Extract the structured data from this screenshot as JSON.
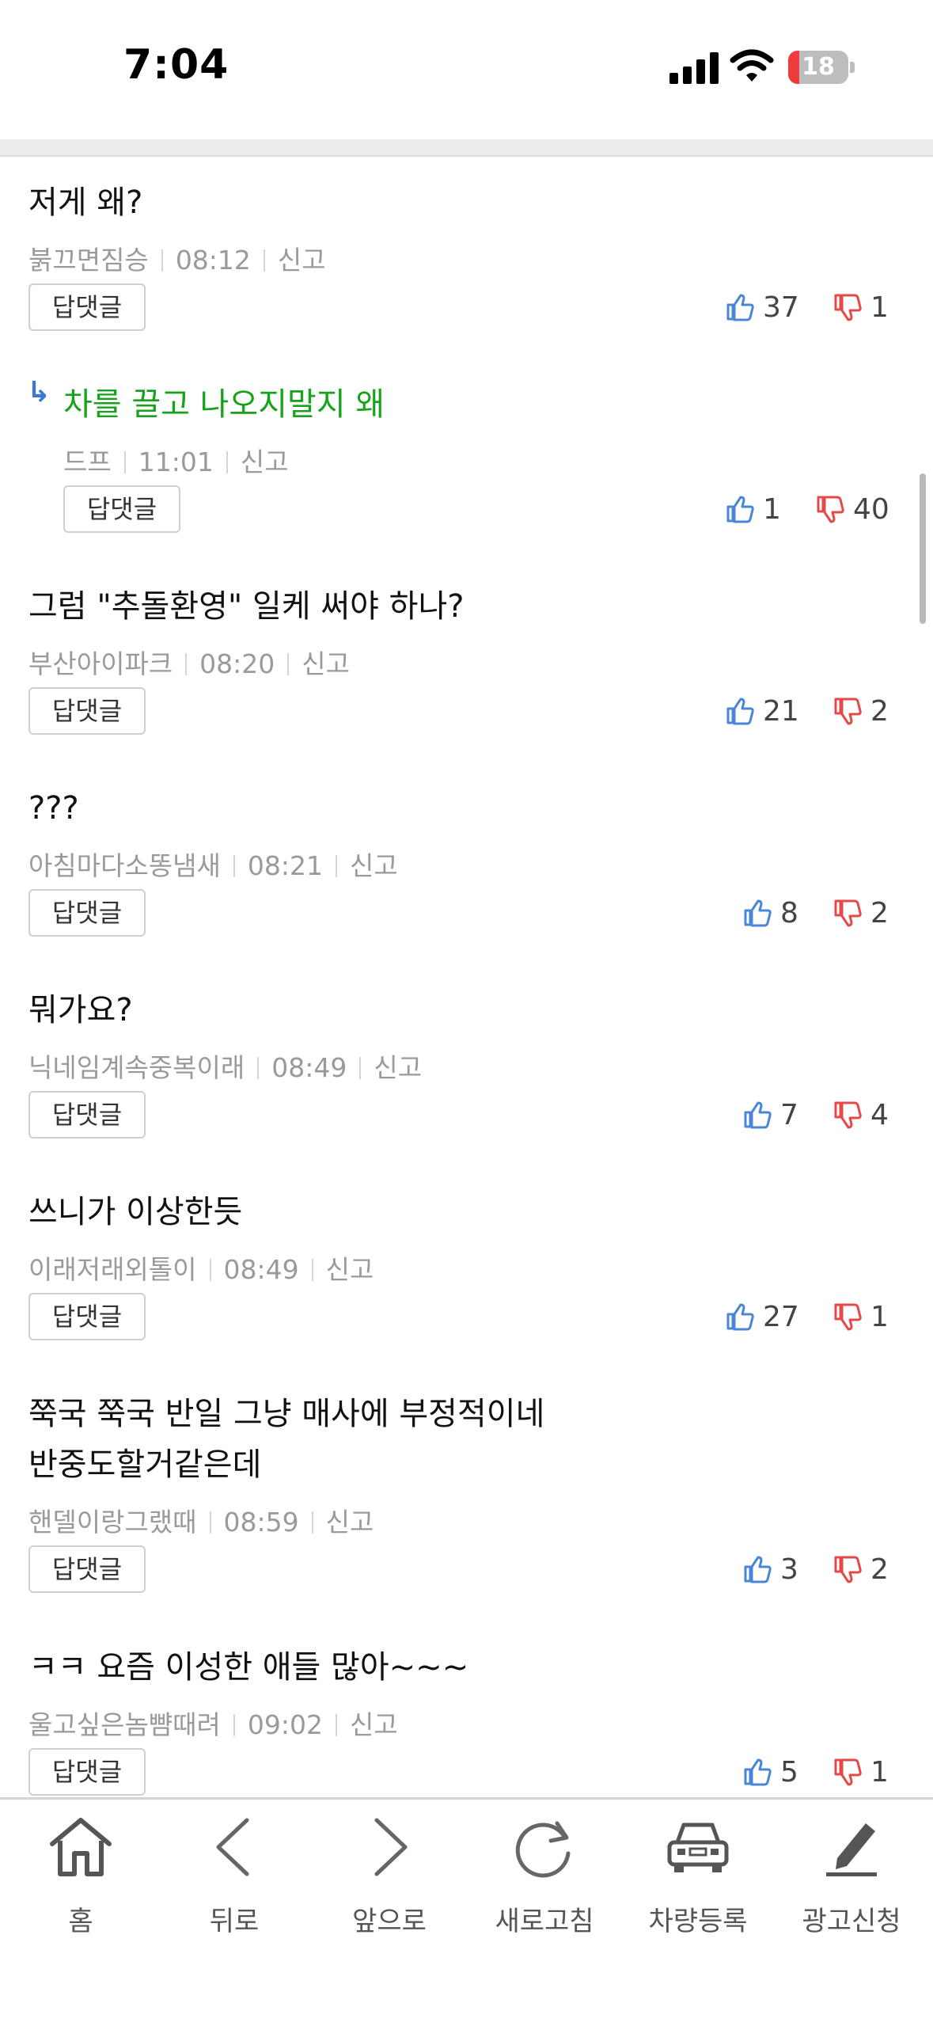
{
  "status": {
    "time": "7:04",
    "battery": "18",
    "battery_level_percent": 18
  },
  "comments": [
    {
      "text": [
        "저게 왜?"
      ],
      "author": "붉끄면짐승",
      "time": "08:12",
      "report": "신고",
      "reply_label": "답댓글",
      "likes": "37",
      "dislikes": "1",
      "is_reply": false
    },
    {
      "text": [
        "차를 끌고 나오지말지 왜"
      ],
      "author": "드프",
      "time": "11:01",
      "report": "신고",
      "reply_label": "답댓글",
      "likes": "1",
      "dislikes": "40",
      "is_reply": true,
      "reply_marker": "↳"
    },
    {
      "text": [
        "그럼 \"추돌환영\" 일케 써야 하나?"
      ],
      "author": "부산아이파크",
      "time": "08:20",
      "report": "신고",
      "reply_label": "답댓글",
      "likes": "21",
      "dislikes": "2",
      "is_reply": false
    },
    {
      "text": [
        "???"
      ],
      "author": "아침마다소똥냄새",
      "time": "08:21",
      "report": "신고",
      "reply_label": "답댓글",
      "likes": "8",
      "dislikes": "2",
      "is_reply": false
    },
    {
      "text": [
        "뭐가요?"
      ],
      "author": "닉네임계속중복이래",
      "time": "08:49",
      "report": "신고",
      "reply_label": "답댓글",
      "likes": "7",
      "dislikes": "4",
      "is_reply": false
    },
    {
      "text": [
        "쓰니가 이상한듯"
      ],
      "author": "이래저래외톨이",
      "time": "08:49",
      "report": "신고",
      "reply_label": "답댓글",
      "likes": "27",
      "dislikes": "1",
      "is_reply": false
    },
    {
      "text": [
        "쭉국 쭉국 반일 그냥 매사에 부정적이네",
        "반중도할거같은데"
      ],
      "author": "핸델이랑그랬때",
      "time": "08:59",
      "report": "신고",
      "reply_label": "답댓글",
      "likes": "3",
      "dislikes": "2",
      "is_reply": false
    },
    {
      "text": [
        "ㅋㅋ 요즘 이성한 애들 많아~~~"
      ],
      "author": "울고싶은놈뺨때려",
      "time": "09:02",
      "report": "신고",
      "reply_label": "답댓글",
      "likes": "5",
      "dislikes": "1",
      "is_reply": false
    }
  ],
  "nav": [
    {
      "label": "홈",
      "icon": "home-icon"
    },
    {
      "label": "뒤로",
      "icon": "chevron-left-icon"
    },
    {
      "label": "앞으로",
      "icon": "chevron-right-icon"
    },
    {
      "label": "새로고침",
      "icon": "refresh-icon"
    },
    {
      "label": "차량등록",
      "icon": "car-icon"
    },
    {
      "label": "광고신청",
      "icon": "pencil-icon"
    }
  ],
  "colors": {
    "like": "#4a86d6",
    "dislike": "#e44a4a",
    "reply_text": "#17a21b",
    "reply_marker": "#3a78d8"
  }
}
